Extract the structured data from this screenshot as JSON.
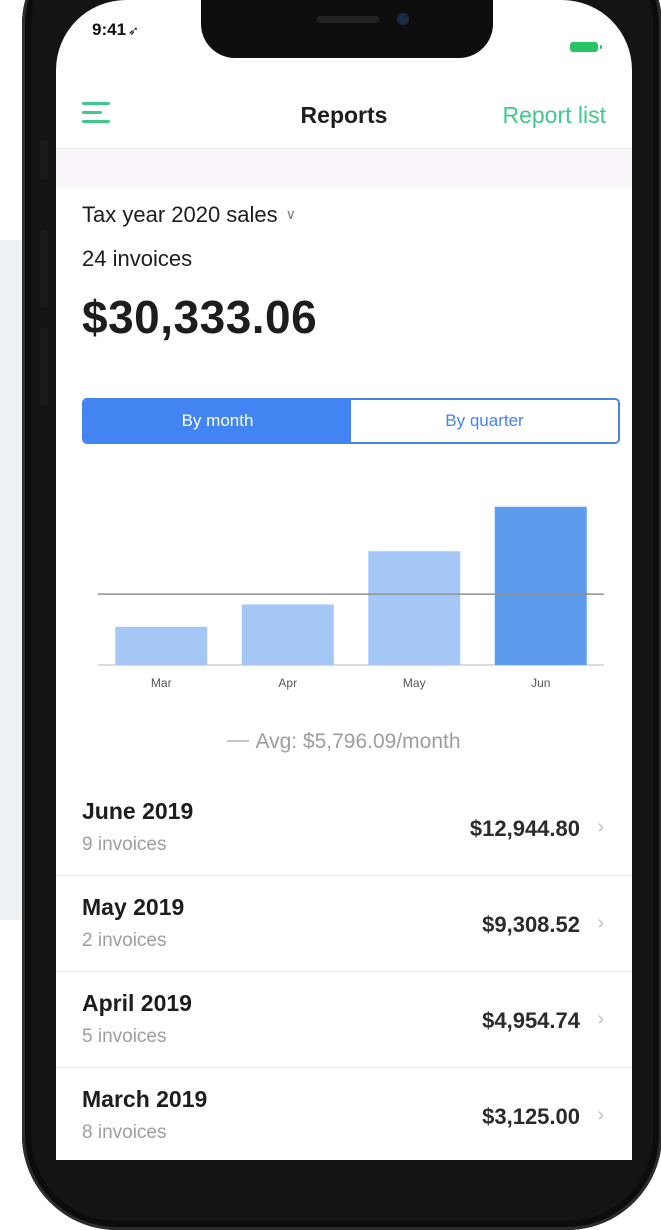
{
  "status": {
    "time": "9:41",
    "location_icon": "location-arrow-icon"
  },
  "nav": {
    "menu_icon": "hamburger-menu-icon",
    "title": "Reports",
    "action": "Report list"
  },
  "summary": {
    "report_name": "Tax year 2020 sales",
    "invoice_count": "24 invoices",
    "total": "$30,333.06"
  },
  "segments": {
    "month": "By month",
    "quarter": "By quarter",
    "selected": "month"
  },
  "colors": {
    "accent_green": "#3fc98a",
    "accent_blue": "#4384f3",
    "bar_light": "#a4c7f5",
    "bar_highlight": "#5d9cec"
  },
  "chart_data": {
    "type": "bar",
    "categories": [
      "Mar",
      "Apr",
      "May",
      "Jun"
    ],
    "values": [
      3125.0,
      4954.74,
      9308.52,
      12944.8
    ],
    "average": 5796.09,
    "highlighted_category": "Jun",
    "ylim": [
      0,
      13500
    ],
    "grid": false
  },
  "chart_legend": {
    "average_label": "Avg: $5,796.09/month"
  },
  "months": [
    {
      "title": "June 2019",
      "subtitle": "9 invoices",
      "amount": "$12,944.80"
    },
    {
      "title": "May 2019",
      "subtitle": "2 invoices",
      "amount": "$9,308.52"
    },
    {
      "title": "April 2019",
      "subtitle": "5 invoices",
      "amount": "$4,954.74"
    },
    {
      "title": "March 2019",
      "subtitle": "8 invoices",
      "amount": "$3,125.00"
    }
  ]
}
